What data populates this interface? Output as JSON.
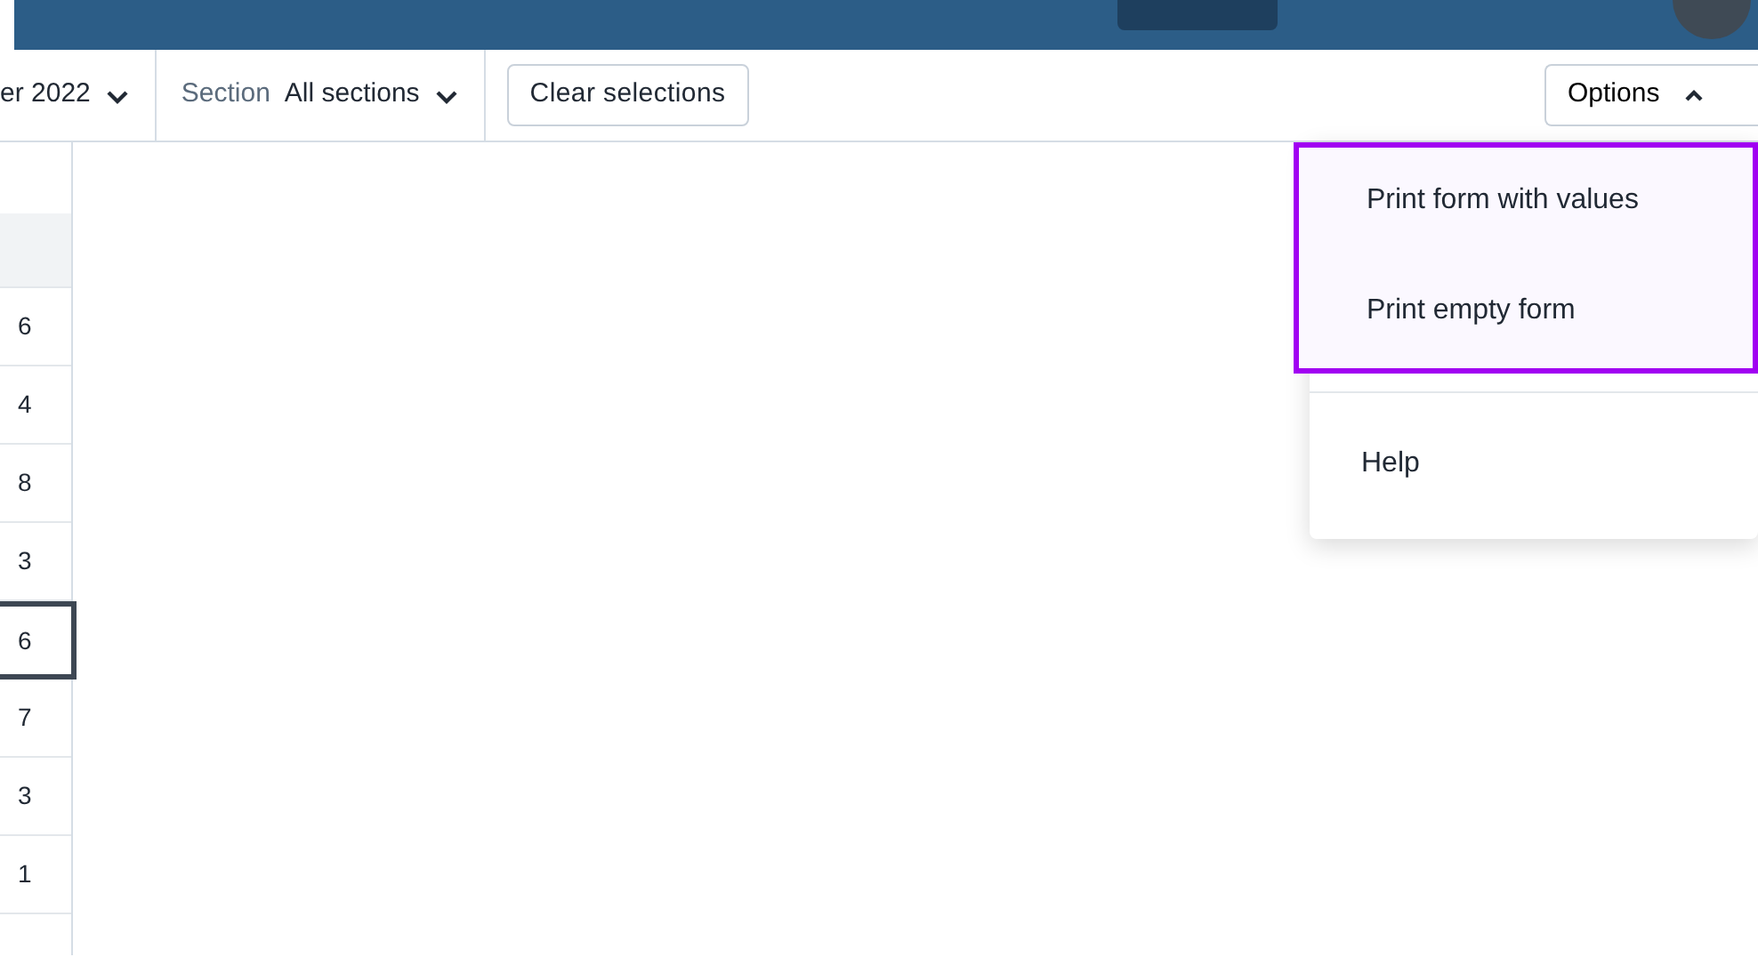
{
  "filters": {
    "period": {
      "value": "er 2022"
    },
    "section": {
      "label": "Section",
      "value": "All sections"
    },
    "clear_button": "Clear selections",
    "options": {
      "label": "Options",
      "expanded": true
    }
  },
  "column_cells": [
    {
      "value": "6",
      "selected": false
    },
    {
      "value": "4",
      "selected": false
    },
    {
      "value": "8",
      "selected": false
    },
    {
      "value": "3",
      "selected": false
    },
    {
      "value": "6",
      "selected": true
    },
    {
      "value": "7",
      "selected": false
    },
    {
      "value": "3",
      "selected": false
    },
    {
      "value": "1",
      "selected": false
    }
  ],
  "options_menu": {
    "sections": [
      {
        "focused": true,
        "items": [
          "Print form with values",
          "Print empty form"
        ]
      },
      {
        "focused": false,
        "items": [
          "Help"
        ]
      }
    ]
  }
}
